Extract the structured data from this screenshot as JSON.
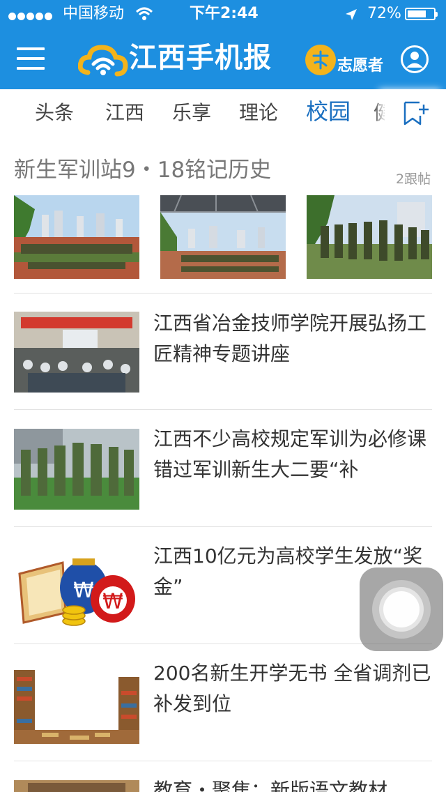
{
  "status_bar": {
    "carrier": "中国移动",
    "time": "下午2:44",
    "battery": "72%",
    "battery_level": 0.72,
    "icons": [
      "signal-dots-icon",
      "wifi-icon",
      "location-arrow-icon",
      "battery-icon"
    ]
  },
  "header": {
    "app_name": "江西手机报",
    "volunteer_label": "志愿者",
    "icons": [
      "menu-icon",
      "cloud-logo-icon",
      "volunteer-icon",
      "user-icon"
    ]
  },
  "tabs": [
    "头条",
    "江西",
    "乐享",
    "理论",
    "校园",
    "健"
  ],
  "active_tab": "校园",
  "gallery": {
    "title": "新生军训站9・18铭记历史",
    "count": "2跟帖"
  },
  "articles": [
    {
      "title": "江西省冶金技师学院开展弘扬工匠精神专题讲座"
    },
    {
      "title": "江西不少高校规定军训为必修课 错过军训新生大二要“补"
    },
    {
      "title": "江西10亿元为高校学生发放“奖金”"
    },
    {
      "title": "200名新生开学无书 全省调剂已补发到位"
    },
    {
      "title": "教育・聚焦：新版语文教材"
    }
  ],
  "colors": {
    "brand_blue": "#1d8fe0",
    "active_tab": "#1a6fc0",
    "volunteer_yellow": "#f3b31b"
  }
}
